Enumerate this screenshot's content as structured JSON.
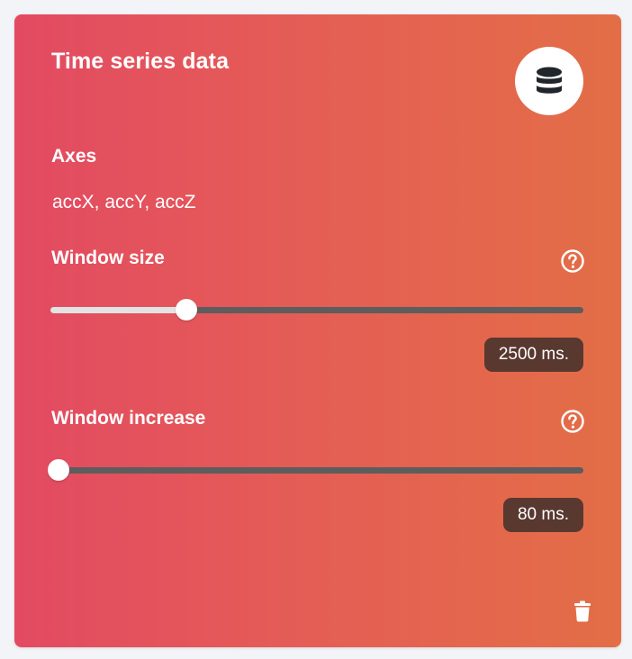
{
  "card": {
    "title": "Time series data",
    "icon": "database-icon",
    "gradient": [
      "#e34a62",
      "#e36e46"
    ]
  },
  "axes": {
    "label": "Axes",
    "value": "accX, accY, accZ"
  },
  "window_size": {
    "label": "Window size",
    "help_icon": "question-circle-icon",
    "value_text": "2500 ms.",
    "position_fraction": 0.255
  },
  "window_increase": {
    "label": "Window increase",
    "help_icon": "question-circle-icon",
    "value_text": "80 ms.",
    "position_fraction": 0.015
  },
  "actions": {
    "delete_icon": "trash-icon"
  },
  "colors": {
    "badge": "#593830",
    "track": "#5d5d5d",
    "track_fill": "#e3e3e3"
  }
}
